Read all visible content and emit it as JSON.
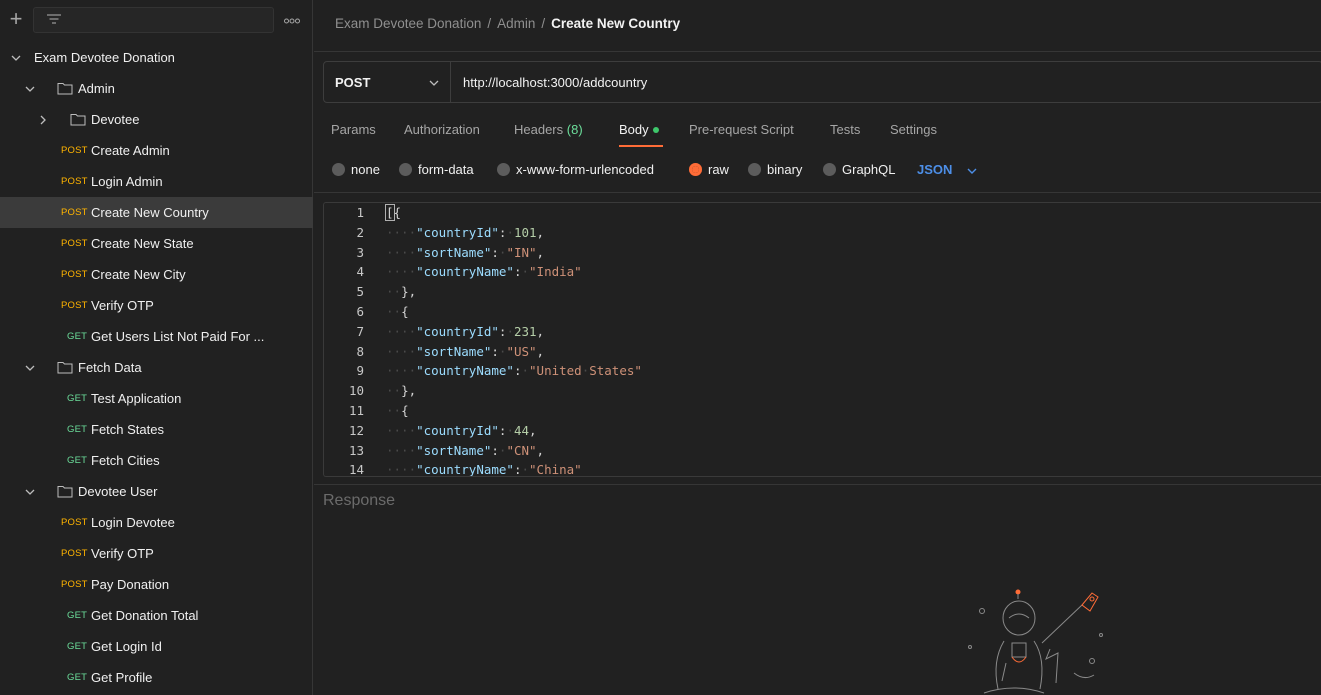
{
  "sidebar": {
    "filter_placeholder": "",
    "more_label": "ooo",
    "tree": [
      {
        "kind": "collection",
        "label": "Exam Devotee Donation"
      },
      {
        "kind": "folder",
        "label": "Admin"
      },
      {
        "kind": "folder",
        "label": "Devotee",
        "collapsed": true
      },
      {
        "kind": "request",
        "method": "POST",
        "label": "Create Admin"
      },
      {
        "kind": "request",
        "method": "POST",
        "label": "Login Admin"
      },
      {
        "kind": "request",
        "method": "POST",
        "label": "Create New Country",
        "selected": true
      },
      {
        "kind": "request",
        "method": "POST",
        "label": "Create New State"
      },
      {
        "kind": "request",
        "method": "POST",
        "label": "Create New City"
      },
      {
        "kind": "request",
        "method": "POST",
        "label": "Verify OTP"
      },
      {
        "kind": "request",
        "method": "GET",
        "label": "Get Users List Not Paid For ..."
      },
      {
        "kind": "folder",
        "label": "Fetch Data"
      },
      {
        "kind": "request",
        "method": "GET",
        "label": "Test Application"
      },
      {
        "kind": "request",
        "method": "GET",
        "label": "Fetch States"
      },
      {
        "kind": "request",
        "method": "GET",
        "label": "Fetch Cities"
      },
      {
        "kind": "folder",
        "label": "Devotee User"
      },
      {
        "kind": "request",
        "method": "POST",
        "label": "Login Devotee"
      },
      {
        "kind": "request",
        "method": "POST",
        "label": "Verify OTP"
      },
      {
        "kind": "request",
        "method": "POST",
        "label": "Pay Donation"
      },
      {
        "kind": "request",
        "method": "GET",
        "label": "Get Donation Total"
      },
      {
        "kind": "request",
        "method": "GET",
        "label": "Get Login Id"
      },
      {
        "kind": "request",
        "method": "GET",
        "label": "Get Profile"
      }
    ]
  },
  "breadcrumb": {
    "collection": "Exam Devotee Donation",
    "folder": "Admin",
    "current": "Create New Country",
    "separator": "/"
  },
  "request": {
    "method": "POST",
    "url": "http://localhost:3000/addcountry"
  },
  "tabs": {
    "params": "Params",
    "authorization": "Authorization",
    "headers": "Headers",
    "headers_count": "(8)",
    "body": "Body",
    "prerequest": "Pre-request Script",
    "tests": "Tests",
    "settings": "Settings"
  },
  "body_options": {
    "none": "none",
    "form_data": "form-data",
    "urlencoded": "x-www-form-urlencoded",
    "raw": "raw",
    "binary": "binary",
    "graphql": "GraphQL",
    "format": "JSON",
    "selected": "raw"
  },
  "editor": {
    "line_numbers": [
      "1",
      "2",
      "3",
      "4",
      "5",
      "6",
      "7",
      "8",
      "9",
      "10",
      "11",
      "12",
      "13",
      "14"
    ],
    "lines": [
      "[{",
      "    \"countryId\": 101,",
      "    \"sortName\": \"IN\",",
      "    \"countryName\": \"India\"",
      "  },",
      "  {",
      "    \"countryId\": 231,",
      "    \"sortName\": \"US\",",
      "    \"countryName\": \"United States\"",
      "  },",
      "  {",
      "    \"countryId\": 44,",
      "    \"sortName\": \"CN\",",
      "    \"countryName\": \"China\""
    ]
  },
  "response": {
    "label": "Response"
  },
  "colors": {
    "post": "#ffb400",
    "get": "#6bdd9a",
    "accent": "#ff6c37",
    "json_format": "#4d8fe8"
  }
}
